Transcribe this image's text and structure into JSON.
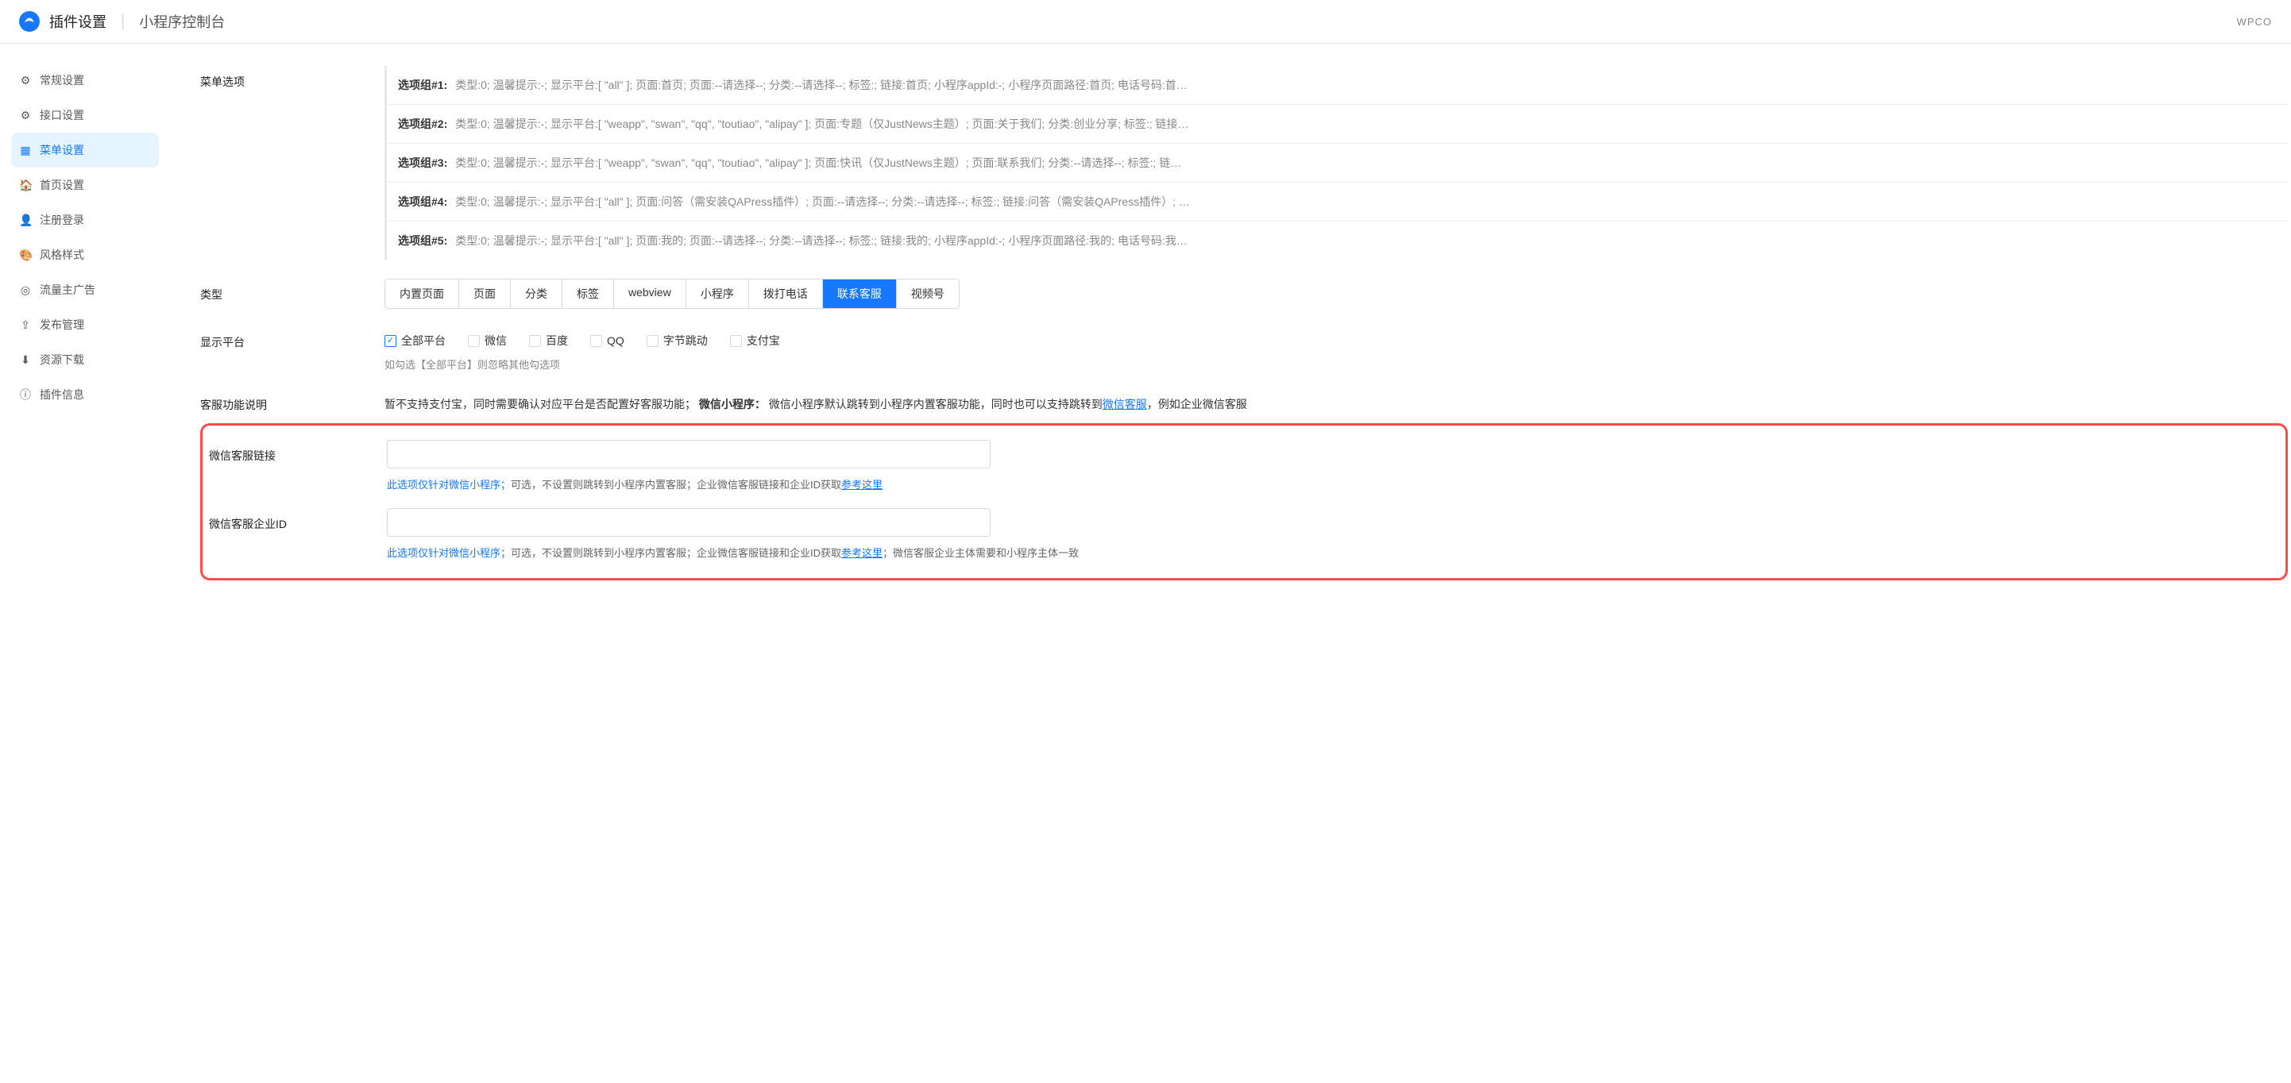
{
  "header": {
    "title": "插件设置",
    "subtitle": "小程序控制台",
    "right": "WPCO"
  },
  "sidebar": {
    "items": [
      {
        "icon": "⚙",
        "label": "常规设置"
      },
      {
        "icon": "⚙",
        "label": "接口设置"
      },
      {
        "icon": "▦",
        "label": "菜单设置"
      },
      {
        "icon": "🏠",
        "label": "首页设置"
      },
      {
        "icon": "👤",
        "label": "注册登录"
      },
      {
        "icon": "🎨",
        "label": "风格样式"
      },
      {
        "icon": "◎",
        "label": "流量主广告"
      },
      {
        "icon": "⇪",
        "label": "发布管理"
      },
      {
        "icon": "⬇",
        "label": "资源下载"
      },
      {
        "icon": "ⓘ",
        "label": "插件信息"
      }
    ],
    "activeIndex": 2
  },
  "menuOptions": {
    "label": "菜单选项",
    "rows": [
      {
        "key": "选项组#1:",
        "val": "类型:0; 温馨提示:-; 显示平台:[ \"all\" ]; 页面:首页; 页面:--请选择--; 分类:--请选择--; 标签:; 链接:首页; 小程序appId:-; 小程序页面路径:首页; 电话号码:首…"
      },
      {
        "key": "选项组#2:",
        "val": "类型:0; 温馨提示:-; 显示平台:[ \"weapp\", \"swan\", \"qq\", \"toutiao\", \"alipay\" ]; 页面:专题（仅JustNews主题）; 页面:关于我们; 分类:创业分享; 标签:; 链接…"
      },
      {
        "key": "选项组#3:",
        "val": "类型:0; 温馨提示:-; 显示平台:[ \"weapp\", \"swan\", \"qq\", \"toutiao\", \"alipay\" ]; 页面:快讯（仅JustNews主题）; 页面:联系我们; 分类:--请选择--; 标签:; 链…"
      },
      {
        "key": "选项组#4:",
        "val": "类型:0; 温馨提示:-; 显示平台:[ \"all\" ]; 页面:问答（需安装QAPress插件）; 页面:--请选择--; 分类:--请选择--; 标签:; 链接:问答（需安装QAPress插件）; …"
      },
      {
        "key": "选项组#5:",
        "val": "类型:0; 温馨提示:-; 显示平台:[ \"all\" ]; 页面:我的; 页面:--请选择--; 分类:--请选择--; 标签:; 链接:我的; 小程序appId:-; 小程序页面路径:我的; 电话号码:我…"
      }
    ]
  },
  "typeRow": {
    "label": "类型",
    "tabs": [
      "内置页面",
      "页面",
      "分类",
      "标签",
      "webview",
      "小程序",
      "拨打电话",
      "联系客服",
      "视频号"
    ],
    "activeIndex": 7
  },
  "platformRow": {
    "label": "显示平台",
    "checks": [
      {
        "label": "全部平台",
        "checked": true
      },
      {
        "label": "微信",
        "checked": false
      },
      {
        "label": "百度",
        "checked": false
      },
      {
        "label": "QQ",
        "checked": false
      },
      {
        "label": "字节跳动",
        "checked": false
      },
      {
        "label": "支付宝",
        "checked": false
      }
    ],
    "hint": "如勾选【全部平台】则忽略其他勾选项"
  },
  "serviceDesc": {
    "label": "客服功能说明",
    "part1": "暂不支持支付宝，同时需要确认对应平台是否配置好客服功能；",
    "bold": "微信小程序：",
    "part2": "微信小程序默认跳转到小程序内置客服功能，同时也可以支持跳转到",
    "linkText": "微信客服",
    "part3": "，例如企业微信客服"
  },
  "wxLink": {
    "label": "微信客服链接",
    "value": "",
    "hintBlue": "此选项仅针对微信小程序；",
    "hintGray": "可选，不设置则跳转到小程序内置客服；企业微信客服链接和企业ID获取",
    "hintLink": "参考这里"
  },
  "wxCorp": {
    "label": "微信客服企业ID",
    "value": "",
    "hintBlue": "此选项仅针对微信小程序；",
    "hintGray1": "可选，不设置则跳转到小程序内置客服；企业微信客服链接和企业ID获取",
    "hintLink": "参考这里",
    "hintGray2": "；微信客服企业主体需要和小程序主体一致"
  }
}
